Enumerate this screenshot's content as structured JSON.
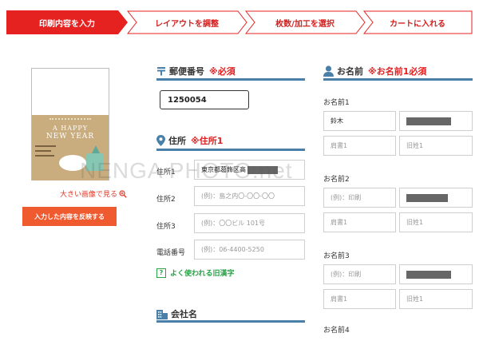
{
  "steps": [
    {
      "label": "印刷内容を入力",
      "active": true
    },
    {
      "label": "レイアウトを調整",
      "active": false
    },
    {
      "label": "枚数/加工を選択",
      "active": false
    },
    {
      "label": "カートに入れる",
      "active": false
    }
  ],
  "preview": {
    "card_line1": "A HAPPY",
    "card_line2": "NEW YEAR",
    "enlarge_label": "大きい画像で見る",
    "reflect_button": "入力した内容を反映する"
  },
  "watermark": "NENGA PHOTO.net",
  "postal": {
    "title": "郵便番号",
    "required": "※必須",
    "value": "1250054"
  },
  "address": {
    "title": "住所",
    "required": "※住所1",
    "rows": [
      {
        "label": "住所1",
        "value": "東京都葛飾区高",
        "placeholder": ""
      },
      {
        "label": "住所2",
        "value": "",
        "placeholder": "(例)：島之内〇-〇〇-〇〇"
      },
      {
        "label": "住所3",
        "value": "",
        "placeholder": "(例)：〇〇ビル 101号"
      },
      {
        "label": "電話番号",
        "value": "",
        "placeholder": "(例)：06-4400-5250"
      }
    ],
    "kanji_link": "よく使われる旧漢字",
    "kanji_icon_text": "?"
  },
  "company": {
    "title": "会社名"
  },
  "names": {
    "title": "お名前",
    "required": "※お名前1必須",
    "groups": [
      {
        "label": "お名前1",
        "surname": "鈴木",
        "surname_placeholder": "",
        "title_placeholder": "肩書1",
        "old_placeholder": "旧姓1"
      },
      {
        "label": "お名前2",
        "surname": "",
        "surname_placeholder": "(例)：印刷",
        "title_placeholder": "肩書1",
        "old_placeholder": "旧姓1"
      },
      {
        "label": "お名前3",
        "surname": "",
        "surname_placeholder": "(例)：印刷",
        "title_placeholder": "肩書1",
        "old_placeholder": "旧姓1"
      },
      {
        "label": "お名前4"
      }
    ]
  },
  "colors": {
    "active_step": "#e62221",
    "step_border": "#e62221",
    "accent_blue": "#4a80a8",
    "required_red": "#e02020",
    "reflect_button": "#ef5a2f",
    "link_green": "#2ea24a"
  }
}
